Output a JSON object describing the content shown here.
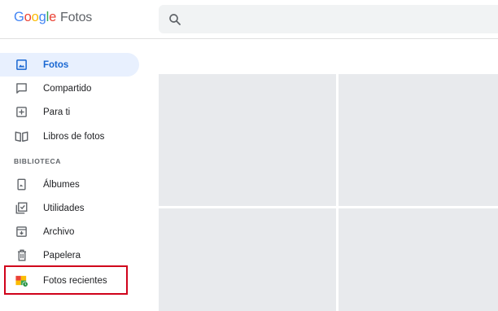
{
  "app": {
    "logo_google": "Google",
    "logo_product": "Fotos"
  },
  "colors": {
    "accent": "#1a73e8",
    "active_bg": "#e8f0fe",
    "placeholder": "#e8eaed",
    "highlight_border": "#d0021b"
  },
  "search": {
    "icon": "search-icon"
  },
  "sidebar": {
    "items": [
      {
        "label": "Fotos",
        "icon": "photo-icon",
        "active": true
      },
      {
        "label": "Compartido",
        "icon": "chat-bubble-icon"
      },
      {
        "label": "Para ti",
        "icon": "add-box-icon"
      },
      {
        "label": "Libros de fotos",
        "icon": "book-icon"
      }
    ],
    "section_title": "BIBLIOTECA",
    "library": [
      {
        "label": "Álbumes",
        "icon": "album-icon"
      },
      {
        "label": "Utilidades",
        "icon": "utilities-icon"
      },
      {
        "label": "Archivo",
        "icon": "archive-icon"
      },
      {
        "label": "Papelera",
        "icon": "trash-icon"
      },
      {
        "label": "Fotos recientes",
        "icon": "recent-photos-icon",
        "highlighted": true
      }
    ]
  }
}
